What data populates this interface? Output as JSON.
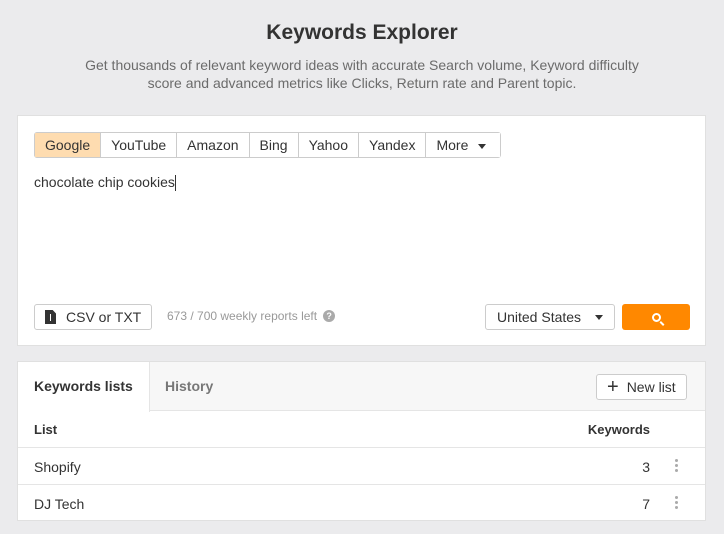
{
  "header": {
    "title": "Keywords Explorer",
    "subtitle": "Get thousands of relevant keyword ideas with accurate Search volume, Keyword difficulty score and advanced metrics like Clicks, Return rate and Parent topic."
  },
  "search": {
    "engines": [
      "Google",
      "YouTube",
      "Amazon",
      "Bing",
      "Yahoo",
      "Yandex"
    ],
    "more_label": "More",
    "active_engine": "Google",
    "query": "chocolate chip cookies",
    "csv_label": "CSV or TXT",
    "reports_left": "673 / 700 weekly reports left",
    "country": "United States",
    "accent": "#ff8800"
  },
  "lists": {
    "tabs": [
      "Keywords lists",
      "History"
    ],
    "new_list_label": "New list",
    "columns": [
      "List",
      "Keywords"
    ],
    "rows": [
      {
        "name": "Shopify",
        "keywords": "3"
      },
      {
        "name": "DJ Tech",
        "keywords": "7"
      }
    ]
  }
}
